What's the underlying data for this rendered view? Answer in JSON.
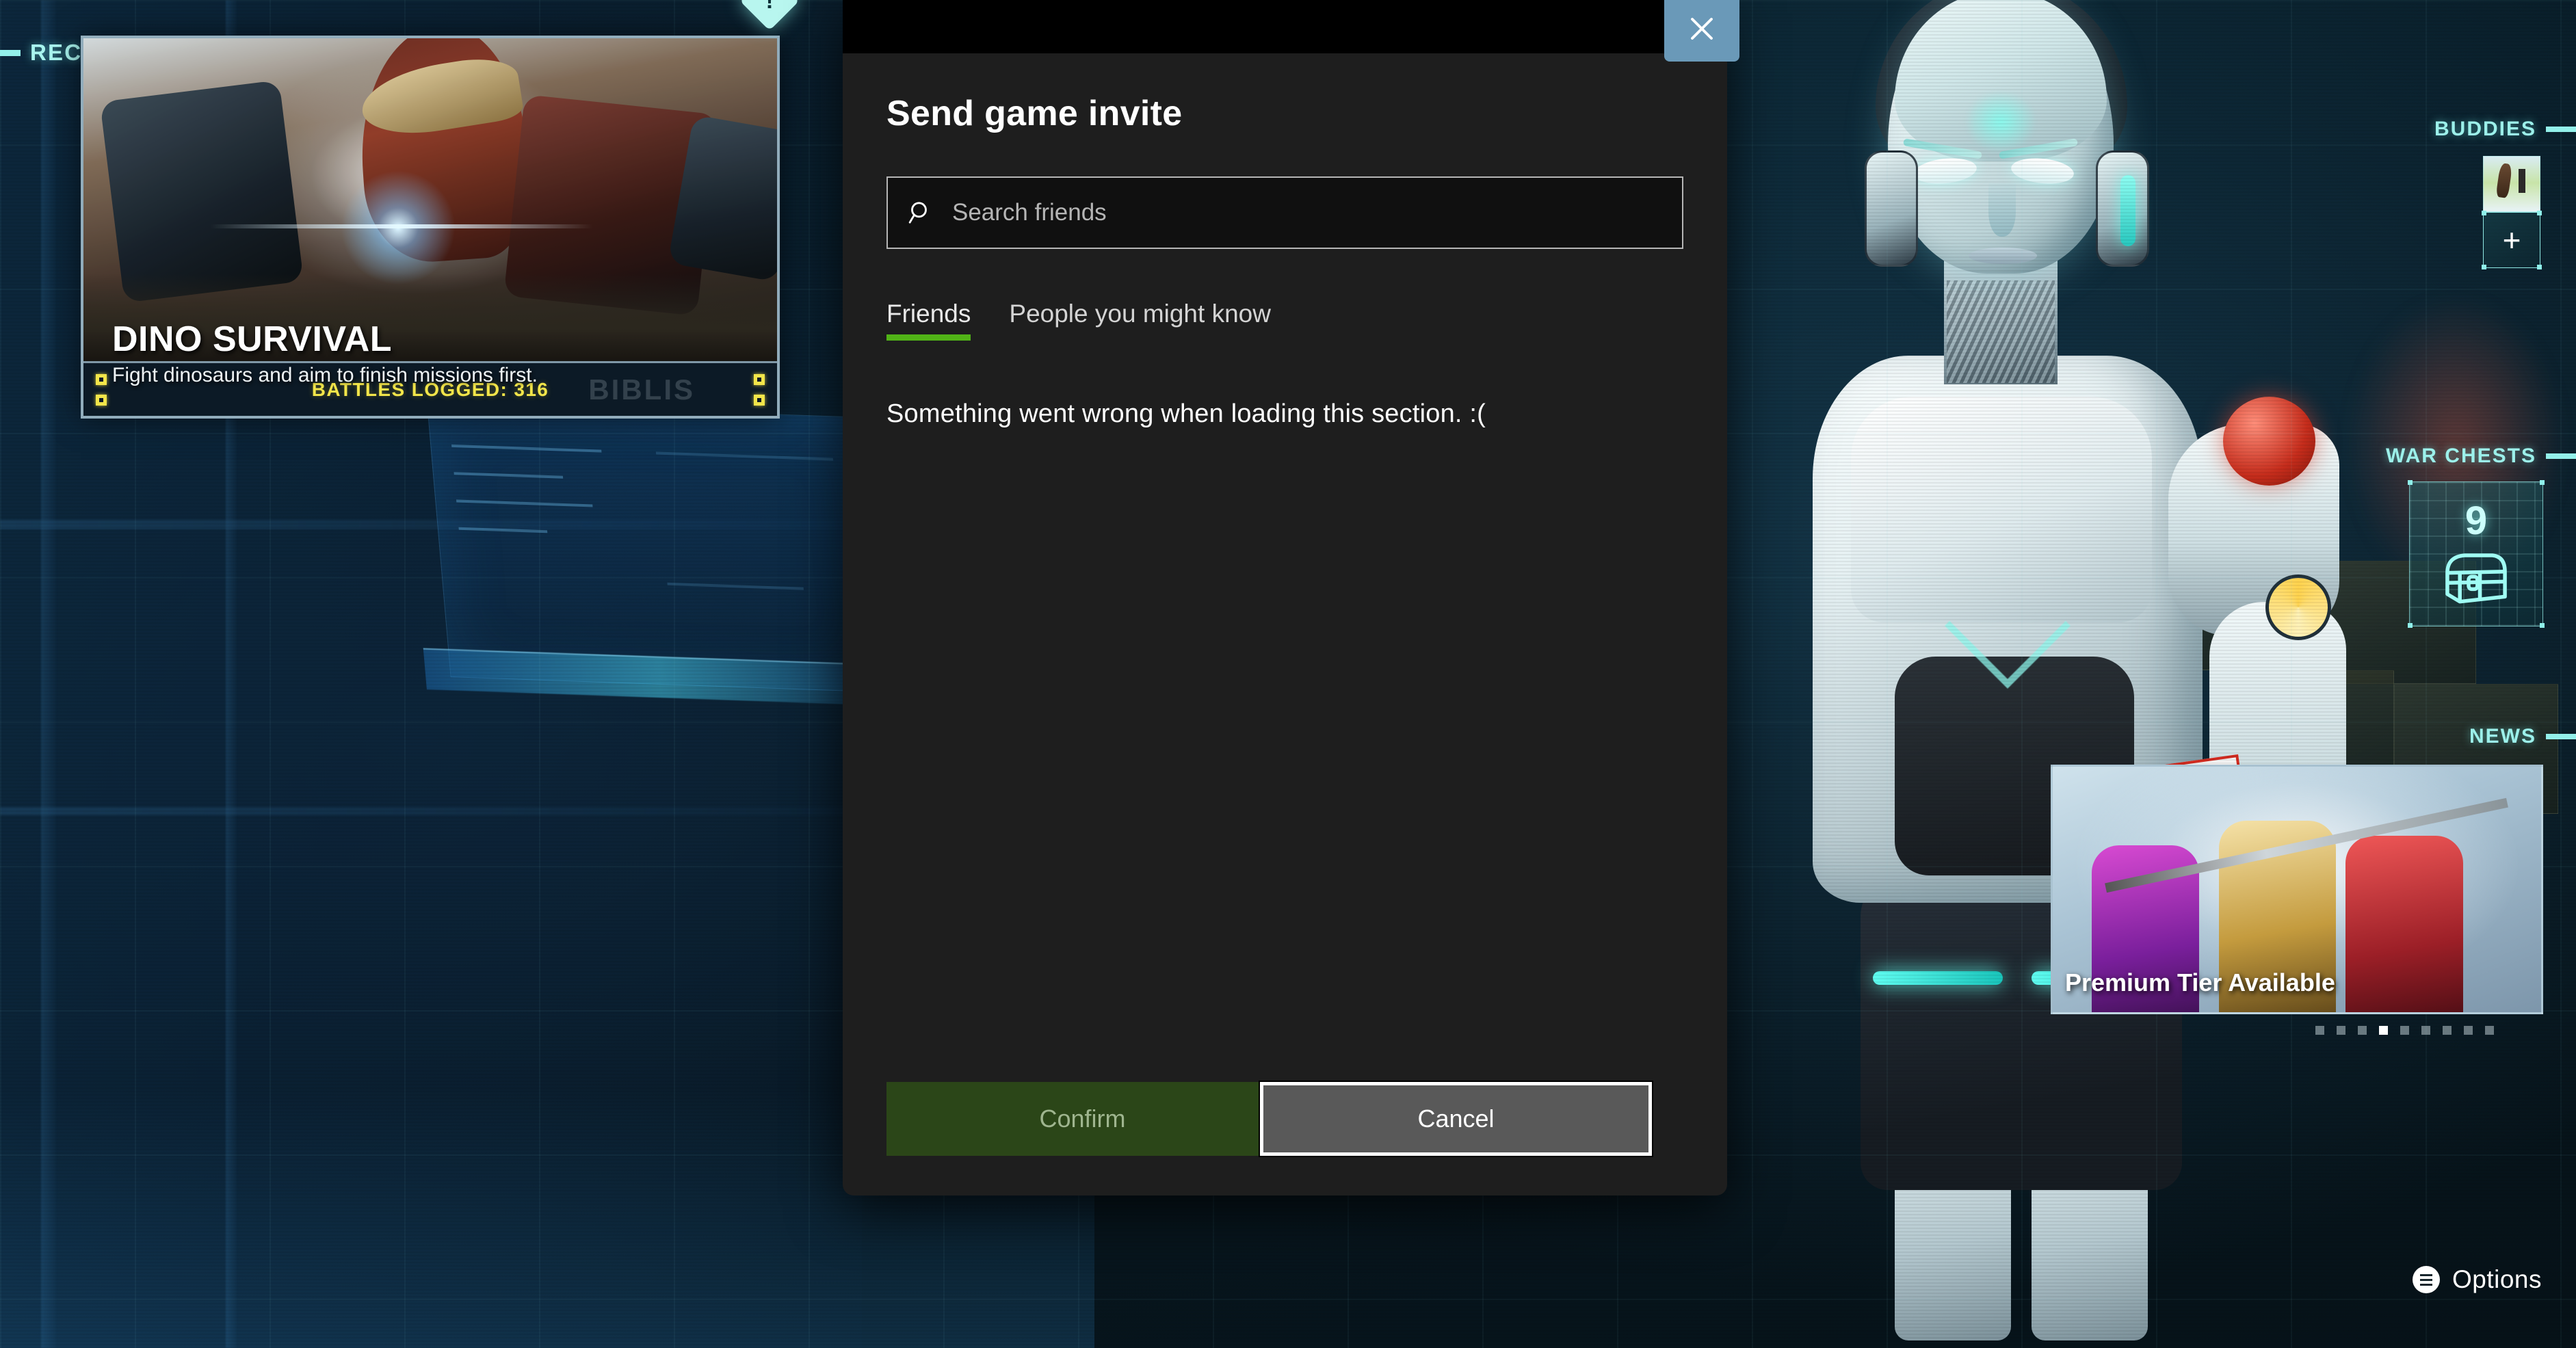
{
  "background": {
    "recommended": {
      "section_label": "RECOMMENDED",
      "card": {
        "title": "DINO SURVIVAL",
        "subtitle": "Fight dinosaurs and aim to finish missions first.",
        "footer_stat": "BATTLES LOGGED: 316",
        "watermark": "BIBLIS"
      }
    },
    "notification_badge": "!",
    "buddies": {
      "section_label": "BUDDIES",
      "add_label": "+"
    },
    "war_chests": {
      "section_label": "WAR CHESTS",
      "count": "9",
      "icon": "treasure-chest-icon"
    },
    "news": {
      "section_label": "NEWS",
      "headline": "Premium Tier Available",
      "total_dots": 9,
      "active_dot": 4
    },
    "options": {
      "label": "Options",
      "icon": "hamburger-menu-icon"
    }
  },
  "modal": {
    "title": "Send game invite",
    "close_label": "Close",
    "close_icon": "close-icon",
    "search": {
      "icon": "search-icon",
      "placeholder": "Search friends",
      "value": ""
    },
    "tabs": [
      {
        "label": "Friends",
        "active": true
      },
      {
        "label": "People you might know",
        "active": false
      }
    ],
    "section_message": "Something went wrong when loading this section. :(",
    "buttons": {
      "confirm": "Confirm",
      "cancel": "Cancel"
    }
  },
  "colors": {
    "accent_green": "#51b317",
    "accent_cyan": "#9cf0ea",
    "confirm_bg": "#2b4618",
    "cancel_bg": "#595959",
    "modal_bg": "#1e1e1e",
    "close_bg": "#6a99b8",
    "card_stat_yellow": "#f2e54a"
  }
}
